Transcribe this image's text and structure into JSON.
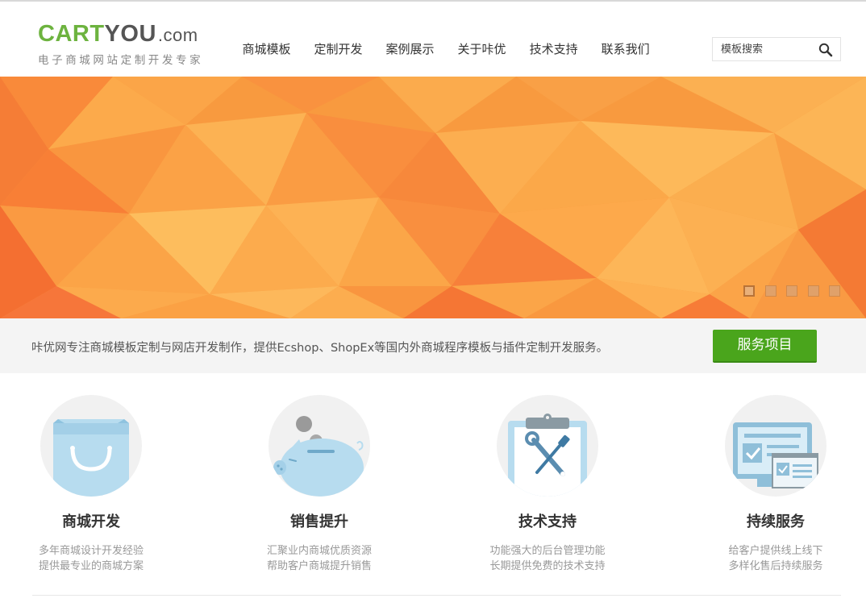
{
  "logo": {
    "cart": "CART",
    "you": "YOU",
    "domain": ".com",
    "tagline": "电子商城网站定制开发专家"
  },
  "nav": {
    "items": [
      {
        "label": "商城模板"
      },
      {
        "label": "定制开发"
      },
      {
        "label": "案例展示"
      },
      {
        "label": "关于咔优"
      },
      {
        "label": "技术支持"
      },
      {
        "label": "联系我们"
      }
    ]
  },
  "search": {
    "placeholder": "模板搜索",
    "icon": "search-icon"
  },
  "banner": {
    "slide_count": 5,
    "active_slide": 1
  },
  "strip": {
    "text": "咔优网专注商城模板定制与网店开发制作，提供Ecshop、ShopEx等国内外商城程序模板与插件定制开发服务。",
    "button_label": "服务项目"
  },
  "features": [
    {
      "title": "商城开发",
      "line1": "多年商城设计开发经验",
      "line2": "提供最专业的商城方案",
      "icon": "shopping-bag-icon"
    },
    {
      "title": "销售提升",
      "line1": "汇聚业内商城优质资源",
      "line2": "帮助客户商城提升销售",
      "icon": "piggy-bank-icon"
    },
    {
      "title": "技术支持",
      "line1": "功能强大的后台管理功能",
      "line2": "长期提供免费的技术支持",
      "icon": "clipboard-tools-icon"
    },
    {
      "title": "持续服务",
      "line1": "给客户提供线上线下",
      "line2": "多样化售后持续服务",
      "icon": "monitor-checklist-icon"
    }
  ],
  "colors": {
    "brand_green": "#6db33f",
    "button_green": "#4aa51c",
    "banner_orange": "#f79a3e",
    "icon_blue": "#b7dcef"
  }
}
